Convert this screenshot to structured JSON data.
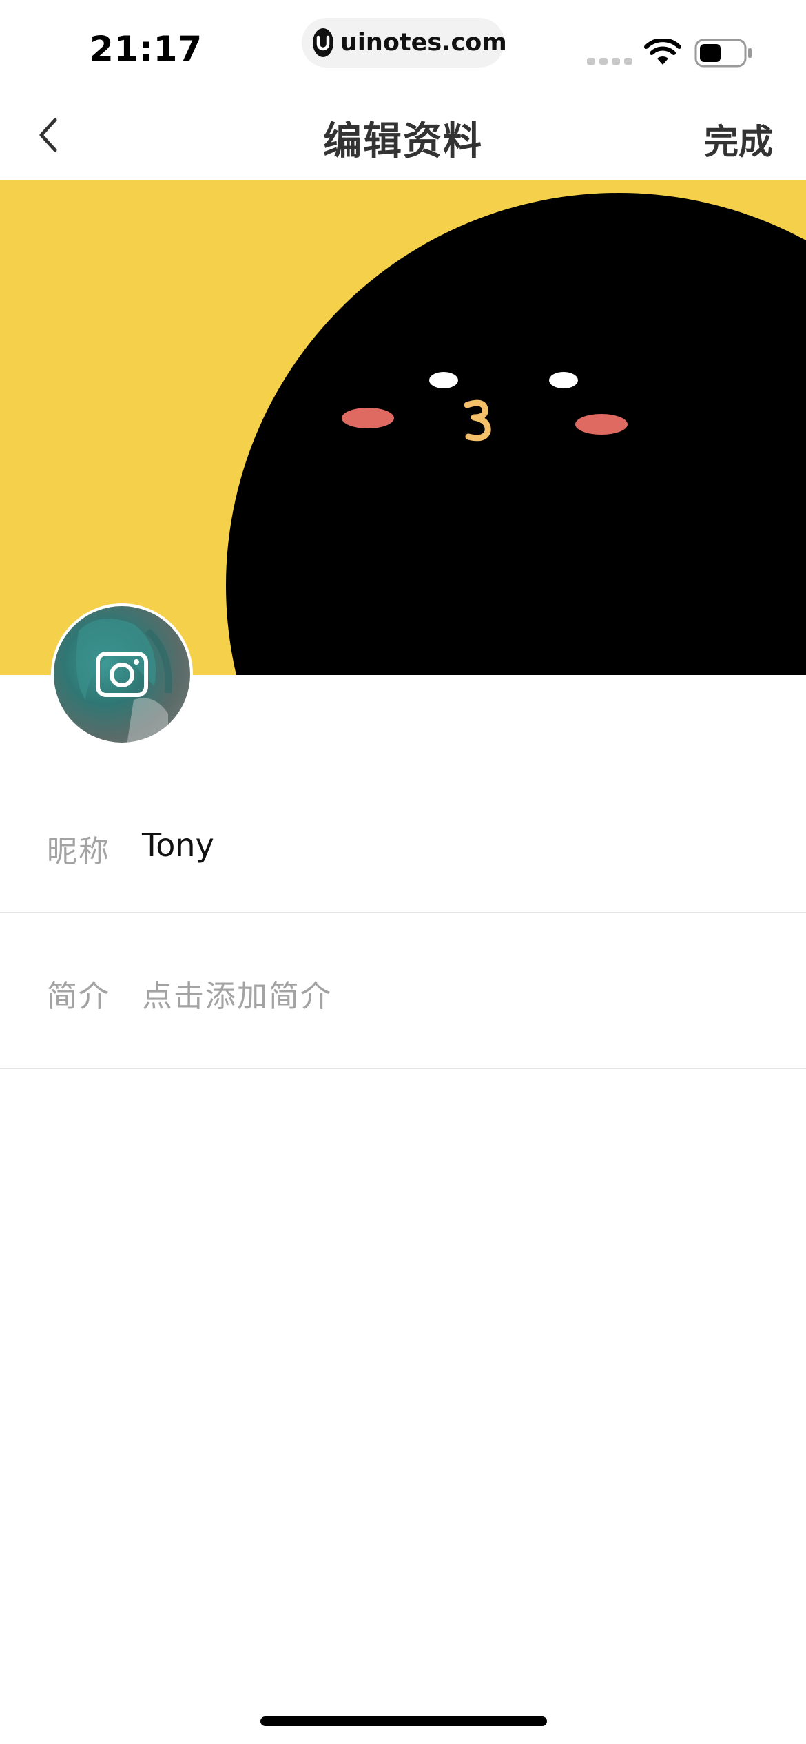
{
  "status_bar": {
    "time": "21:17",
    "url": "uinotes.com",
    "url_logo_letter": "U"
  },
  "nav": {
    "title": "编辑资料",
    "done_label": "完成"
  },
  "profile": {
    "nickname_label": "昵称",
    "nickname_value": "Tony",
    "bio_label": "简介",
    "bio_placeholder": "点击添加简介"
  },
  "colors": {
    "cover_background": "#f5d04a",
    "cover_character": "#000000",
    "blush": "#de6a62",
    "mouth": "#f4c06a",
    "label_gray": "#a3a3a3",
    "divider": "#e3e3e3"
  },
  "icons": {
    "back": "chevron-left-icon",
    "camera": "camera-icon",
    "wifi": "wifi-icon",
    "battery": "battery-icon"
  }
}
